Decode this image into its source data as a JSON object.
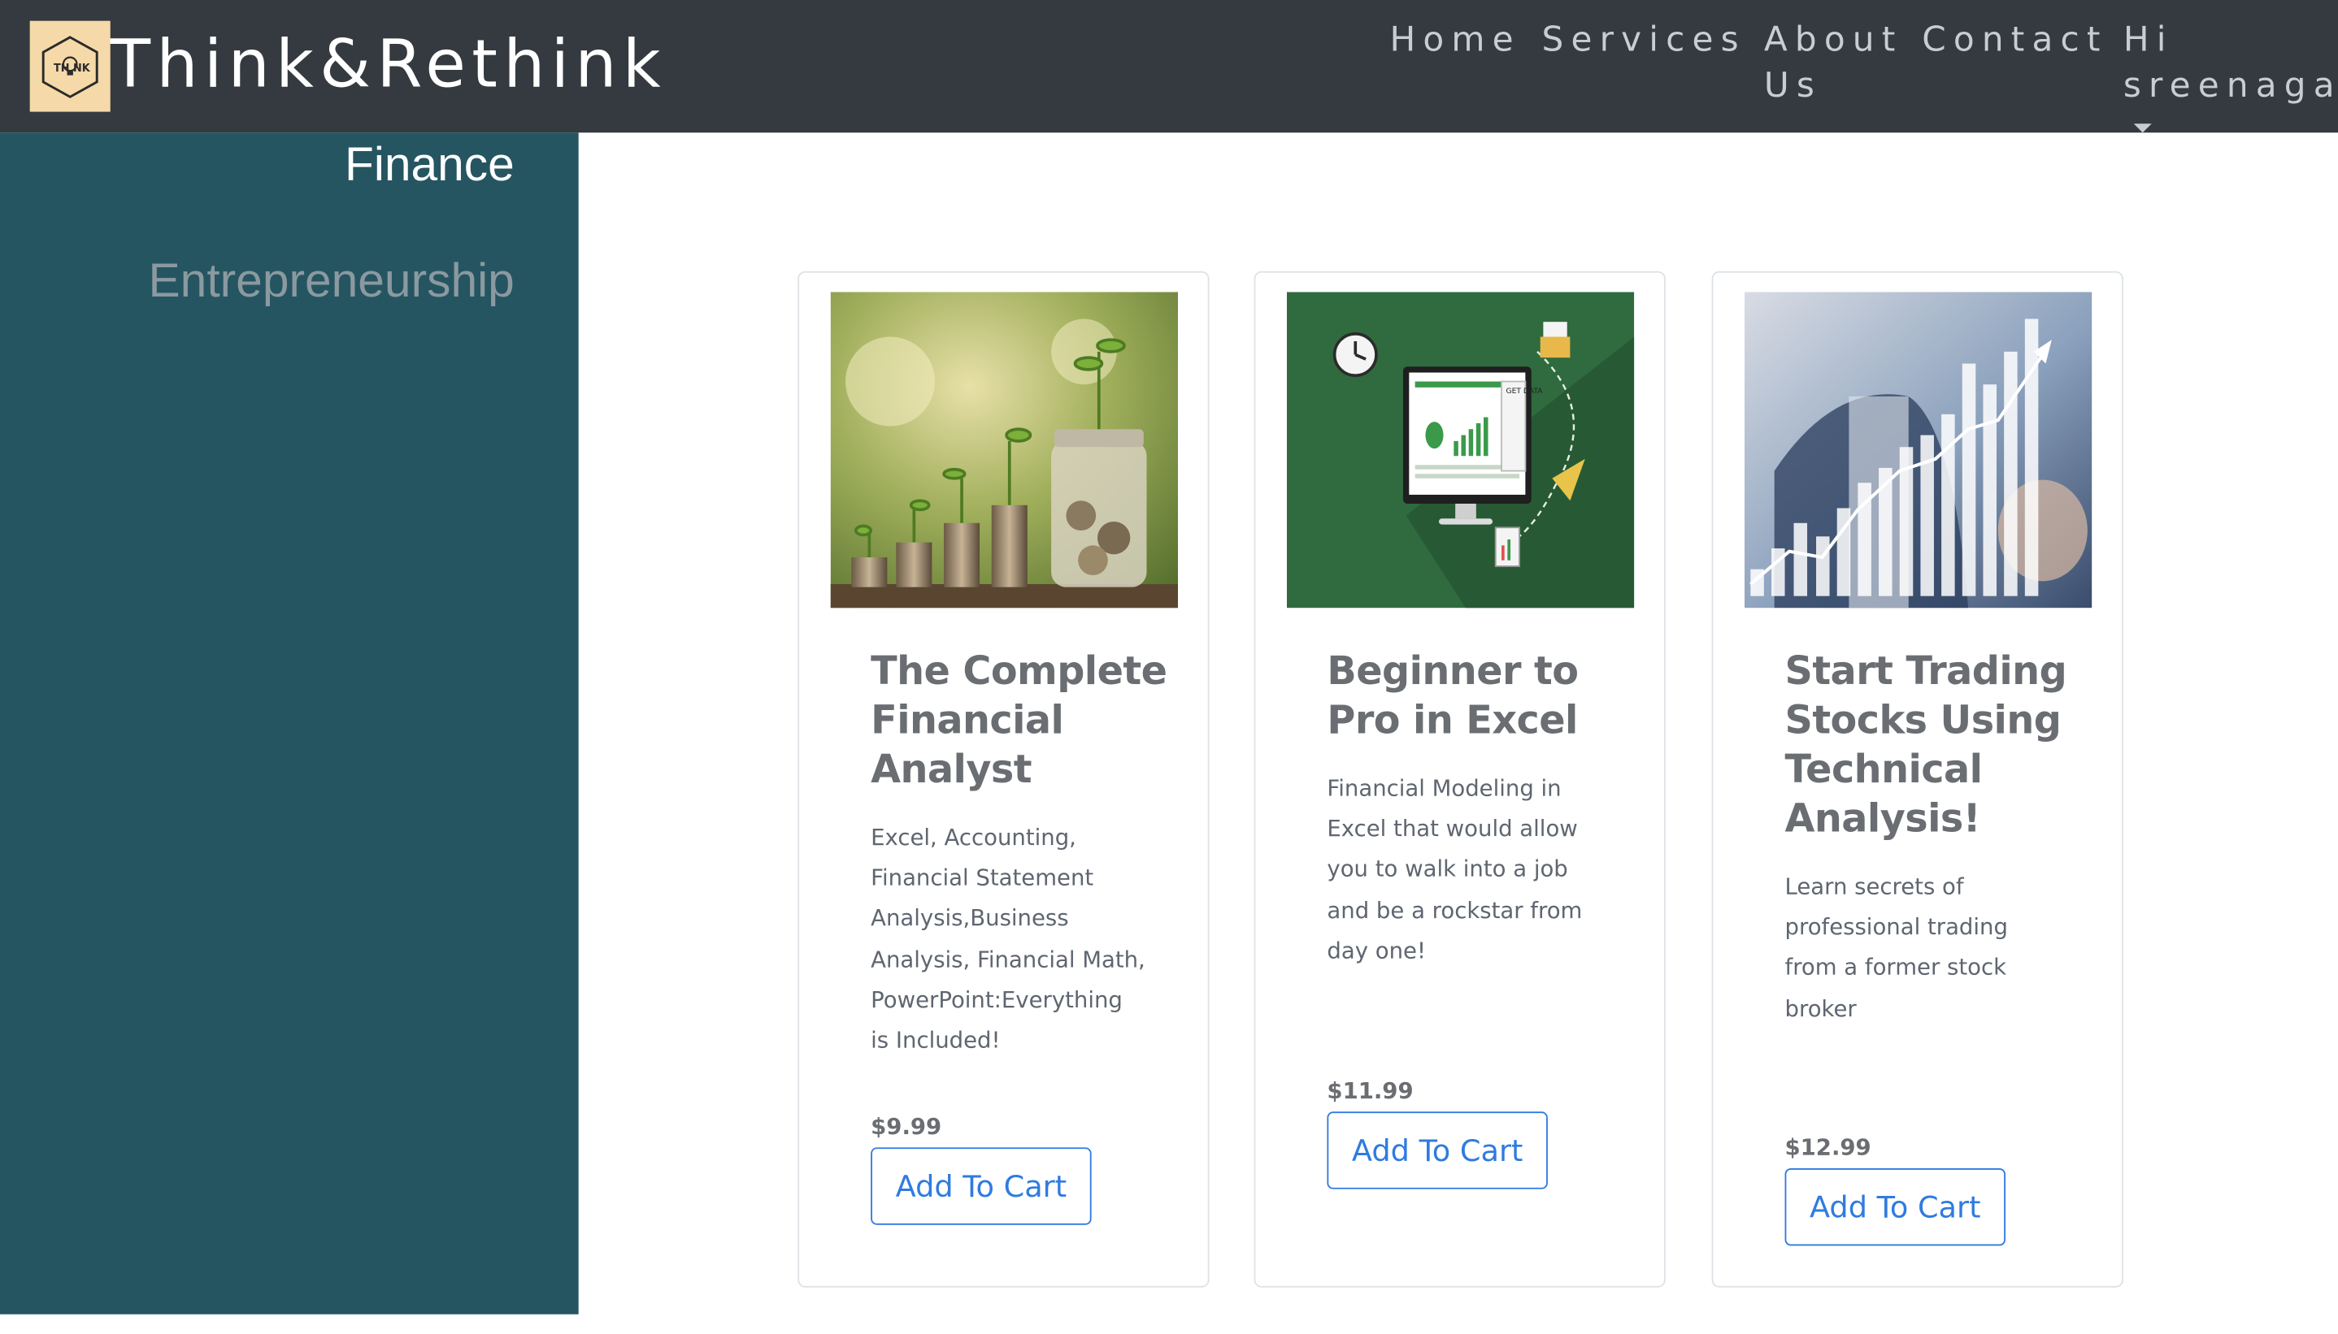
{
  "brand": {
    "logo_icon": "think-lightbulb-logo",
    "logo_text": "TH NK",
    "name": "Think&Rethink"
  },
  "nav": {
    "home": "Home",
    "services": "Services",
    "about": "About Us",
    "contact": "Contact",
    "user_greeting": "Hi sreenagas"
  },
  "sidebar": {
    "items": [
      {
        "label": "Finance",
        "active": true
      },
      {
        "label": "Entrepreneurship",
        "active": false
      }
    ]
  },
  "courses": [
    {
      "image": "coins-plants-photo",
      "title": "The Complete Financial Analyst",
      "description": "Excel, Accounting, Financial Statement Analysis,Business Analysis, Financial Math, PowerPoint:Everything is Included!",
      "price": "$9.99",
      "button": "Add To Cart"
    },
    {
      "image": "excel-dashboard-illustration",
      "title": "Beginner to Pro in Excel",
      "description": "Financial Modeling in Excel that would allow you to walk into a job and be a rockstar from day one!",
      "price": "$11.99",
      "button": "Add To Cart"
    },
    {
      "image": "stock-chart-photo",
      "title": "Start Trading Stocks Using Technical Analysis!",
      "description": "Learn secrets of professional trading from a former stock broker",
      "price": "$12.99",
      "button": "Add To Cart"
    }
  ],
  "illustration_text": {
    "get_data": "GET DATA"
  },
  "colors": {
    "header_bg": "#343a40",
    "sidebar_bg": "#265562",
    "accent": "#2f7be0",
    "logo_bg": "#f5d9a8"
  }
}
